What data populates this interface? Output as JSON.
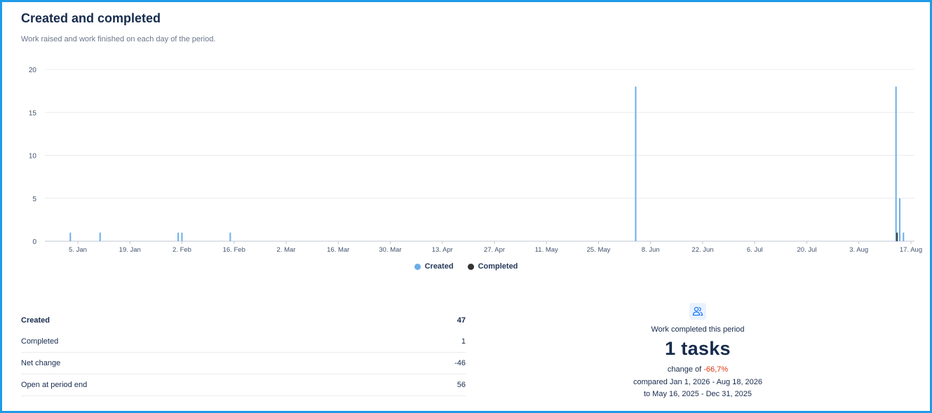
{
  "header": {
    "title": "Created and completed",
    "subtitle": "Work raised and work finished on each day of the period."
  },
  "chart_data": {
    "type": "bar",
    "y_ticks": [
      "0",
      "5",
      "10",
      "15",
      "20"
    ],
    "ylim": [
      0,
      20
    ],
    "x_tick_labels": [
      "5. Jan",
      "19. Jan",
      "2. Feb",
      "16. Feb",
      "2. Mar",
      "16. Mar",
      "30. Mar",
      "13. Apr",
      "27. Apr",
      "11. May",
      "25. May",
      "8. Jun",
      "22. Jun",
      "6. Jul",
      "20. Jul",
      "3. Aug",
      "17. Aug"
    ],
    "x_range": [
      "2026-01-01",
      "2026-08-18"
    ],
    "grid": true,
    "legend_position": "bottom",
    "series": [
      {
        "name": "Created",
        "color": "#6aaeea",
        "points": [
          {
            "date": "2026-01-06",
            "value": 1
          },
          {
            "date": "2026-01-14",
            "value": 1
          },
          {
            "date": "2026-02-04",
            "value": 1
          },
          {
            "date": "2026-02-05",
            "value": 1
          },
          {
            "date": "2026-02-18",
            "value": 1
          },
          {
            "date": "2026-06-07",
            "value": 18
          },
          {
            "date": "2026-08-16",
            "value": 18
          },
          {
            "date": "2026-08-17",
            "value": 5
          },
          {
            "date": "2026-08-18",
            "value": 1
          }
        ]
      },
      {
        "name": "Completed",
        "color": "#333333",
        "points": [
          {
            "date": "2026-08-16",
            "value": 1
          }
        ]
      }
    ]
  },
  "stats": {
    "created_label": "Created",
    "created_value": "47",
    "completed_label": "Completed",
    "completed_value": "1",
    "net_label": "Net change",
    "net_value": "-46",
    "open_label": "Open at period end",
    "open_value": "56"
  },
  "summary": {
    "icon": "people-icon",
    "label": "Work completed this period",
    "value": "1 tasks",
    "change_prefix": "change of",
    "change_value": "-66,7%",
    "compared": "compared Jan 1, 2026 - Aug 18, 2026",
    "to": "to May 16, 2025 - Dec 31, 2025"
  },
  "colors": {
    "accent_border": "#1e9be8",
    "created": "#6aaeea",
    "completed": "#333333",
    "negative": "#de350b"
  }
}
